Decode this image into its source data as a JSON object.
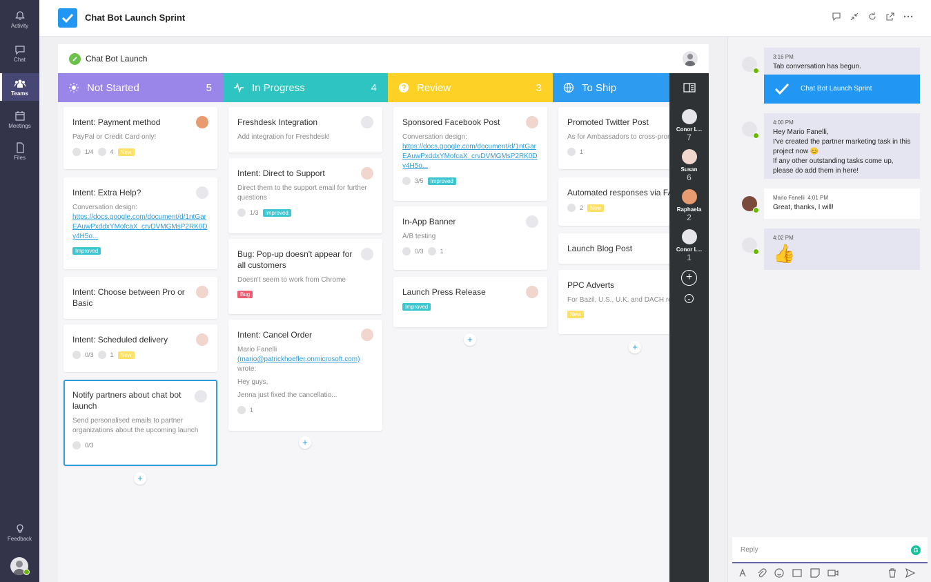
{
  "rail": {
    "items": [
      {
        "label": "Activity",
        "icon": "bell-icon"
      },
      {
        "label": "Chat",
        "icon": "chat-icon"
      },
      {
        "label": "Teams",
        "icon": "teams-icon"
      },
      {
        "label": "Meetings",
        "icon": "calendar-icon"
      },
      {
        "label": "Files",
        "icon": "file-icon"
      }
    ],
    "feedback": "Feedback"
  },
  "header": {
    "title": "Chat Bot Launch Sprint",
    "actions": [
      "conversation-icon",
      "collapse-icon",
      "refresh-icon",
      "popout-icon",
      "more-icon"
    ]
  },
  "board": {
    "name": "Chat Bot Launch",
    "columns": [
      {
        "name": "Not Started",
        "count": "5",
        "color": "#9a86e8",
        "icon": "lightbulb-icon",
        "cards": [
          {
            "title": "Intent: Payment method",
            "desc": "PayPal or Credit Card only!",
            "checklist": "1/4",
            "comments": "4",
            "tag": "New"
          },
          {
            "title": "Intent: Extra Help?",
            "desc": "Conversation design:",
            "link": "https://docs.google.com/document/d/1ntGarEAuwPxddxYMofcaX_crvDVMGMsP2RK0Dy4H5o...",
            "tag": "Improved"
          },
          {
            "title": "Intent: Choose between Pro or Basic"
          },
          {
            "title": "Intent: Scheduled delivery",
            "checklist": "0/3",
            "comments": "1",
            "tag": "New"
          },
          {
            "title": "Notify partners about chat bot launch",
            "desc": "Send personalised emails to partner organizations about the upcoming launch",
            "checklist": "0/3"
          }
        ]
      },
      {
        "name": "In Progress",
        "count": "4",
        "color": "#2ec4c1",
        "icon": "pulse-icon",
        "cards": [
          {
            "title": "Freshdesk Integration",
            "desc": "Add integration for Freshdesk!"
          },
          {
            "title": "Intent: Direct to Support",
            "desc": "Direct them to the support email for further questions",
            "checklist": "1/3",
            "tag": "Improved"
          },
          {
            "title": "Bug: Pop-up doesn't appear for all customers",
            "desc": "Doesn't seem to work from Chrome",
            "tag": "Bug"
          },
          {
            "title": "Intent: Cancel Order",
            "desc": "Mario Fanelli",
            "link": "(mario@patrickhoefler.onmicrosoft.com)",
            "desc2": "wrote:",
            "desc3": "Hey guys,",
            "desc4": "Jenna just fixed the cancellatio...",
            "comments": "1"
          }
        ]
      },
      {
        "name": "Review",
        "count": "3",
        "color": "#fdd125",
        "icon": "question-icon",
        "cards": [
          {
            "title": "Sponsored Facebook Post",
            "desc": "Conversation design:",
            "link": "https://docs.google.com/document/d/1ntGarEAuwPxddxYMofcaX_crvDVMGMsP2RK0Dy4H5o...",
            "checklist": "3/5",
            "tag": "Improved"
          },
          {
            "title": "In-App Banner",
            "desc": "A/B testing",
            "checklist": "0/3",
            "comments": "1"
          },
          {
            "title": "Launch Press Release",
            "tag": "Improved"
          }
        ]
      },
      {
        "name": "To Ship",
        "color": "#2d9cf0",
        "icon": "globe-icon",
        "cards": [
          {
            "title": "Promoted Twitter Post",
            "desc": "As for Ambassadors to cross-promote",
            "comments": "1"
          },
          {
            "title": "Automated responses via FAQ",
            "comments": "2",
            "tag": "New"
          },
          {
            "title": "Launch Blog Post"
          },
          {
            "title": "PPC Adverts",
            "desc": "For Bazil, U.S., U.K. and DACH regions",
            "tag": "New"
          }
        ]
      }
    ]
  },
  "assignees": [
    {
      "name": "Conor L...",
      "count": "7"
    },
    {
      "name": "Susan",
      "count": "6"
    },
    {
      "name": "Raphaela",
      "count": "2"
    },
    {
      "name": "Conor L...",
      "count": "1"
    }
  ],
  "conversation": {
    "messages": [
      {
        "time": "3:16 PM",
        "text": "Tab conversation has begun."
      },
      {
        "time": "4:00 PM",
        "lines": [
          "Hey Mario Fanelli,",
          "I've created the partner marketing task in this project now 😊",
          "If any other outstanding tasks come up, please do add them in here!"
        ]
      },
      {
        "author": "Mario Fanelli",
        "time": "4:01 PM",
        "text": "Great, thanks, I will!"
      },
      {
        "time": "4:02 PM",
        "emoji": "👍"
      }
    ],
    "sprint_card": "Chat Bot Launch Sprint",
    "reply_placeholder": "Reply",
    "grammarly": "G"
  }
}
